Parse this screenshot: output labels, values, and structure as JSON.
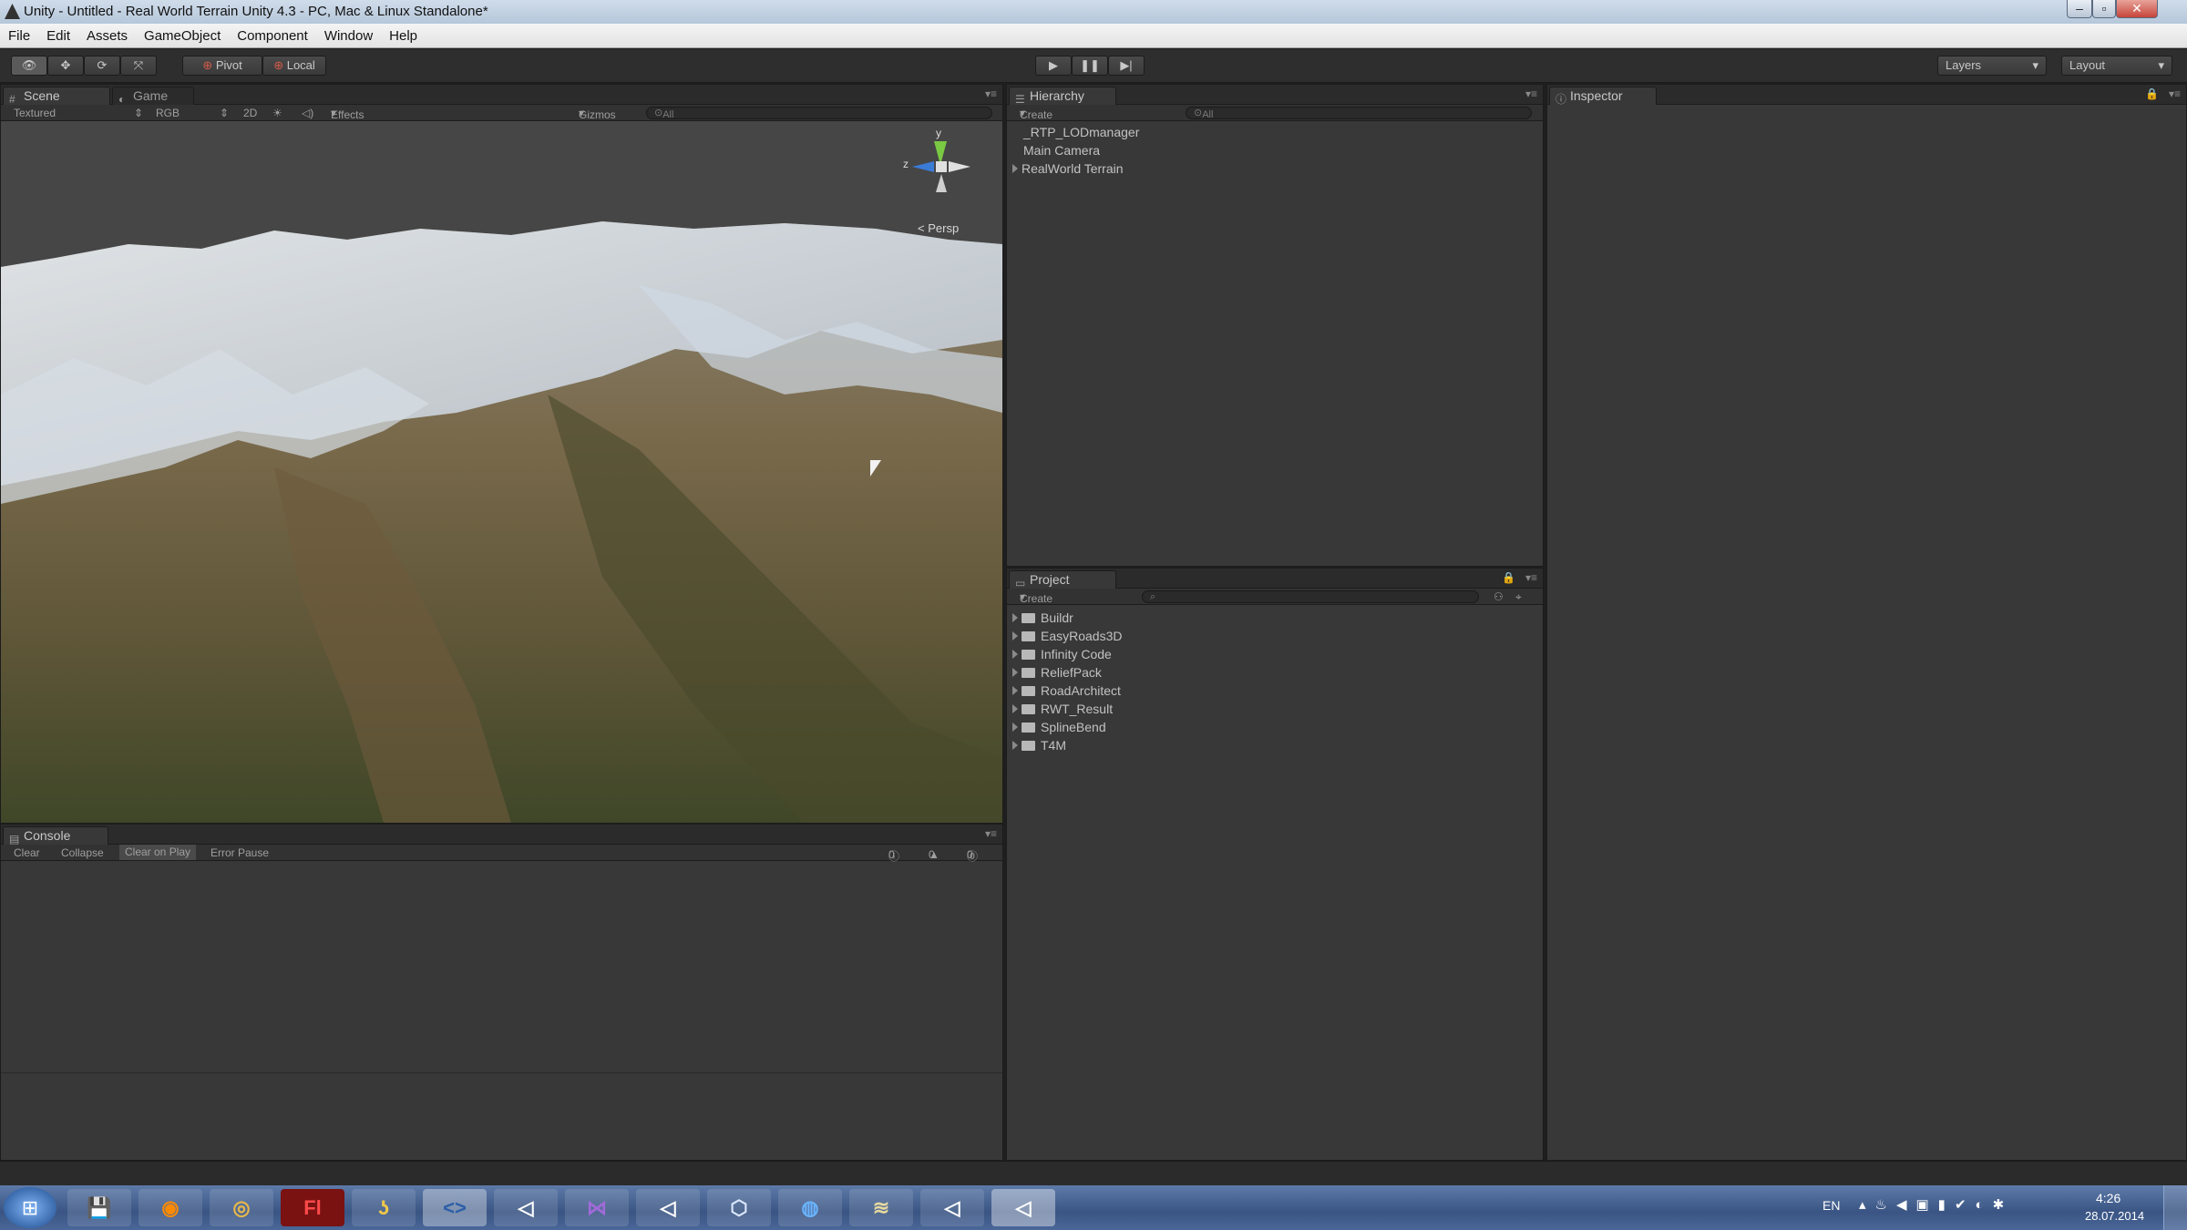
{
  "window": {
    "title": "Unity - Untitled - Real World Terrain Unity 4.3 - PC, Mac & Linux Standalone*"
  },
  "menu": [
    "File",
    "Edit",
    "Assets",
    "GameObject",
    "Component",
    "Window",
    "Help"
  ],
  "toolbar": {
    "pivot": "Pivot",
    "local": "Local",
    "layers": "Layers",
    "layout": "Layout"
  },
  "scene": {
    "tabs": [
      "Scene",
      "Game"
    ],
    "shading": "Textured",
    "render_mode": "RGB",
    "mode2d": "2D",
    "effects": "Effects",
    "gizmos": "Gizmos",
    "search": "All",
    "gizmo_y": "y",
    "gizmo_z": "z",
    "persp": "Persp"
  },
  "hierarchy": {
    "title": "Hierarchy",
    "create": "Create",
    "search": "All",
    "items": [
      "_RTP_LODmanager",
      "Main Camera",
      "RealWorld Terrain"
    ]
  },
  "inspector": {
    "title": "Inspector"
  },
  "project": {
    "title": "Project",
    "create": "Create",
    "folders": [
      "Buildr",
      "EasyRoads3D",
      "Infinity Code",
      "ReliefPack",
      "RoadArchitect",
      "RWT_Result",
      "SplineBend",
      "T4M"
    ]
  },
  "console": {
    "title": "Console",
    "buttons": [
      "Clear",
      "Collapse",
      "Clear on Play",
      "Error Pause"
    ],
    "counts": [
      "0",
      "0",
      "0"
    ]
  },
  "tray": {
    "lang": "EN",
    "time": "4:26",
    "date": "28.07.2014"
  },
  "colors": {
    "editor_bg": "#383838",
    "taskbar": "#3a5583",
    "axis_y": "#7ac943",
    "axis_z": "#3a7bd5"
  }
}
